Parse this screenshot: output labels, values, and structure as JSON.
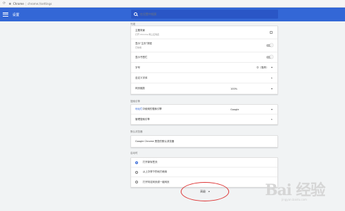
{
  "browser": {
    "tab_label": "Chrome",
    "url_path": "chrome://settings"
  },
  "header": {
    "title": "设置",
    "search_placeholder": "在设置中搜索"
  },
  "appearance": {
    "caption": "外观",
    "theme_label": "主题背景",
    "theme_sub": "打开 Chrome 网上应用店",
    "home_button_label": "显示\"主页\"按钮",
    "home_button_sub": "已停用",
    "bookmarks_bar_label": "显示书签栏",
    "font_size_label": "字号",
    "font_size_value": "中（推荐）",
    "custom_fonts_label": "自定义字体",
    "zoom_label": "网页缩放",
    "zoom_value": "100%"
  },
  "search_engine": {
    "caption": "搜索引擎",
    "address_bar_link": "地址栏",
    "address_bar_label": "中使用的搜索引擎",
    "engine_value": "Google",
    "manage_label": "管理搜索引擎"
  },
  "default_browser": {
    "caption": "默认浏览器",
    "status_text": "Google Chrome 是您的默认浏览器"
  },
  "on_startup": {
    "caption": "启动时",
    "options": [
      "打开新标签页",
      "从上次停下的地方继续",
      "打开特定网页或一组网页"
    ],
    "selected_index": 0
  },
  "advanced": {
    "label": "高级"
  },
  "watermark": {
    "brand": "Bai 经验",
    "url": "jingyan.baidu.com"
  },
  "colors": {
    "header_blue": "#3367d6",
    "background": "#f1f3f4",
    "annotation_red": "#dd3333"
  }
}
